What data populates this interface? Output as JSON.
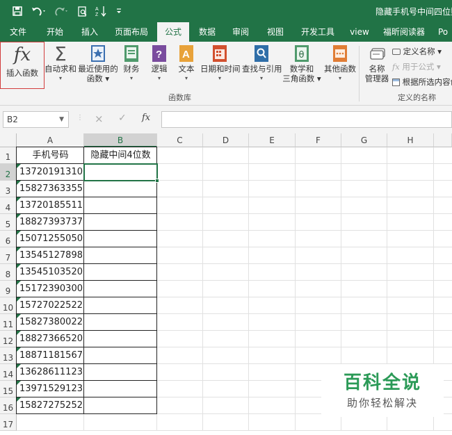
{
  "title_bar": {
    "title": "隐藏手机号中间四位数",
    "save_icon": "save-icon",
    "undo_icon": "undo-icon",
    "redo_icon": "redo-icon",
    "print_preview_icon": "print-preview-icon",
    "sort_icon": "sort-icon",
    "customize_icon": "customize-quick-access-icon"
  },
  "tabs": [
    "文件",
    "开始",
    "插入",
    "页面布局",
    "公式",
    "数据",
    "审阅",
    "视图",
    "开发工具",
    "view",
    "福昕阅读器",
    "Po"
  ],
  "active_tab": "公式",
  "ribbon": {
    "insert_function": "插入函数",
    "insert_function_icon": "fx",
    "autosum": "自动求和",
    "recently_used_line1": "最近使用的",
    "recently_used_line2": "函数",
    "financial": "财务",
    "logical": "逻辑",
    "text": "文本",
    "datetime": "日期和时间",
    "lookup": "查找与引用",
    "math_line1": "数学和",
    "math_line2": "三角函数",
    "more": "其他函数",
    "library_group": "函数库",
    "name_manager_line1": "名称",
    "name_manager_line2": "管理器",
    "define_name": "定义名称",
    "use_in_formula": "用于公式",
    "create_from_selection": "根据所选内容创建",
    "names_group": "定义的名称"
  },
  "formula_bar": {
    "name_box": "B2",
    "cancel": "×",
    "enter": "✓",
    "fx": "fx",
    "value": ""
  },
  "sheet": {
    "columns": [
      "A",
      "B",
      "C",
      "D",
      "E",
      "F",
      "G",
      "H"
    ],
    "rows": [
      "1",
      "2",
      "3",
      "4",
      "5",
      "6",
      "7",
      "8",
      "9",
      "10",
      "11",
      "12",
      "13",
      "14",
      "15",
      "16",
      "17"
    ],
    "header_a": "手机号码",
    "header_b": "隐藏中间4位数",
    "phones": [
      "13720191310",
      "15827363355",
      "13720185511",
      "18827393737",
      "15071255050",
      "13545127898",
      "13545103520",
      "15172390300",
      "15727022522",
      "15827380022",
      "18827366520",
      "18871181567",
      "13628611123",
      "13971529123",
      "15827275252"
    ],
    "selected_cell": "B2"
  },
  "watermark": {
    "line1": "百科全说",
    "line2": "助你轻松解决"
  }
}
